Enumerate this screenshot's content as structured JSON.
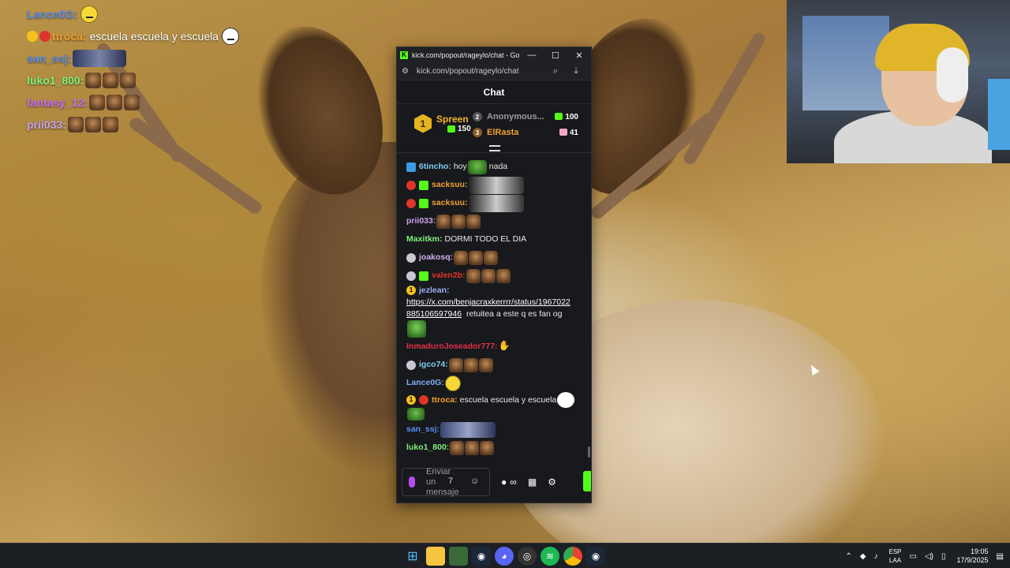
{
  "overlay_chat": [
    {
      "user": "Lance0G:",
      "color": "#5b8ef0",
      "text": "",
      "emote": "smiley"
    },
    {
      "user": "ttroca:",
      "color": "#f0a030",
      "text": "escuela escuela y escuela",
      "badges": [
        "gold",
        "red"
      ]
    },
    {
      "user": "san_ssj:",
      "color": "#5b8ef0",
      "text": "",
      "emote": "wide"
    },
    {
      "user": "luko1_800:",
      "color": "#7ff07a",
      "text": "",
      "emote": "triple"
    },
    {
      "user": "fantasy_12:",
      "color": "#c76ef0",
      "text": "",
      "emote": "triple"
    },
    {
      "user": "prii033:",
      "color": "#c9a0f0",
      "text": "",
      "emote": "triple"
    }
  ],
  "browser": {
    "title": "kick.com/popout/rageylo/chat - Goog...",
    "url": "kick.com/popout/rageylo/chat",
    "minimize": "—",
    "maximize": "☐",
    "close": "✕"
  },
  "chat": {
    "header": "Chat",
    "leaderboard": {
      "first": {
        "rank": "1",
        "name": "Spreen",
        "count": "150"
      },
      "second": {
        "rank": "2",
        "name": "Anonymous...",
        "count": "100"
      },
      "third": {
        "rank": "3",
        "name": "ElRasta",
        "count": "41"
      }
    },
    "messages": [
      {
        "user": "6tincho:",
        "color": "#7fd0f0",
        "text": "hoy",
        "text2": "nada"
      },
      {
        "user": "sacksuu:",
        "color": "#f0a030",
        "text": ""
      },
      {
        "user": "sacksuu:",
        "color": "#f0a030",
        "text": ""
      },
      {
        "user": "prii033:",
        "color": "#c9a0f0",
        "text": ""
      },
      {
        "user": "Maxitkm:",
        "color": "#7ff07a",
        "text": "DORMI TODO EL DIA"
      },
      {
        "user": "joakosq:",
        "color": "#d0b0f0",
        "text": ""
      },
      {
        "user": "valen2b:",
        "color": "#e0342b",
        "text": ""
      },
      {
        "user": "jezlean:",
        "color": "#9ab0f0",
        "text": ""
      },
      {
        "user": "InmaduroJoseador777:",
        "color": "#e0304a",
        "text": ""
      },
      {
        "user": "igco74:",
        "color": "#7fd0f0",
        "text": ""
      },
      {
        "user": "Lance0G:",
        "color": "#7faef0",
        "text": ""
      },
      {
        "user": "ttroca:",
        "color": "#f0a030",
        "text": "escuela escuela y escuela"
      },
      {
        "user": "san_ssj:",
        "color": "#5b8ef0",
        "text": ""
      },
      {
        "user": "luko1_800:",
        "color": "#7ff07a",
        "text": ""
      }
    ],
    "link_line1": "https://x.com/benjacraxkerrrr/status/1967022",
    "link_line2": "885106597946",
    "link_after": "retuitea a este q es fan og",
    "input_placeholder": "Enviar un mensaje"
  },
  "taskbar": {
    "lang_top": "ESP",
    "lang_bottom": "LAA",
    "time": "19:05",
    "date": "17/9/2025"
  },
  "colors": {
    "kick_green": "#53fc18",
    "chat_bg": "#18191c",
    "gold": "#f0b429"
  }
}
